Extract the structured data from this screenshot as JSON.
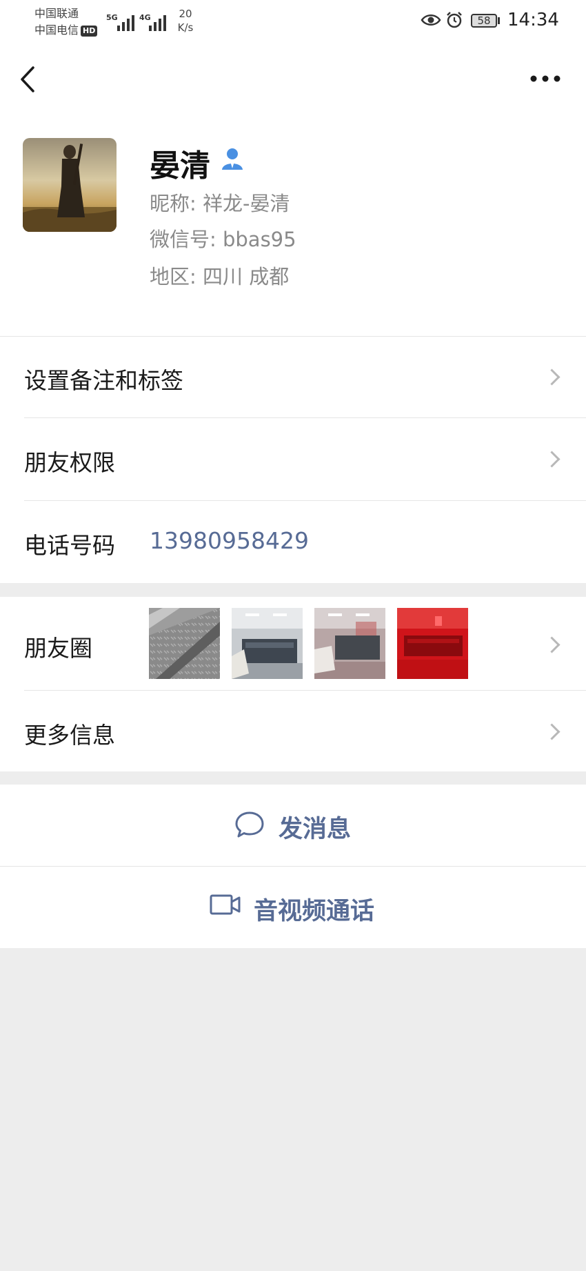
{
  "status_bar": {
    "carrier1": "中国联通",
    "carrier2": "中国电信",
    "hd_badge": "HD",
    "net1": "5G",
    "net2": "4G",
    "speed_value": "20",
    "speed_unit": "K/s",
    "battery": "58",
    "time": "14:34"
  },
  "nav": {
    "back_icon": "chevron-left-icon",
    "more_icon": "more-dots-icon"
  },
  "profile": {
    "name": "晏清",
    "nickname": "昵称: 祥龙-晏清",
    "wechat_id": "微信号: bbas95",
    "region": "地区: 四川  成都"
  },
  "rows": {
    "remark": "设置备注和标签",
    "permissions": "朋友权限",
    "phone_label": "电话号码",
    "phone_value": "13980958429",
    "moments": "朋友圈",
    "more_info": "更多信息"
  },
  "actions": {
    "message": "发消息",
    "video_call": "音视频通话"
  },
  "colors": {
    "link": "#576b95",
    "background": "#ededed",
    "contact_icon": "#4a90e2"
  }
}
